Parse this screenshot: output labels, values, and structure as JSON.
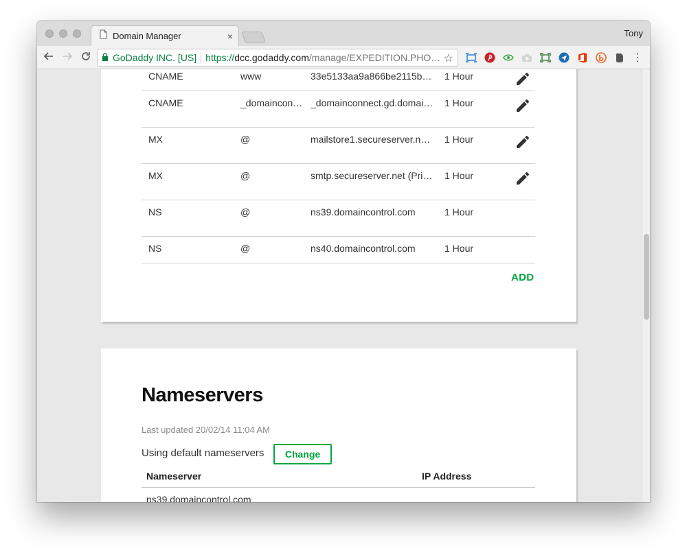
{
  "browser": {
    "tab_title": "Domain Manager",
    "tab_close": "×",
    "profile_name": "Tony",
    "secure_label": "GoDaddy INC. [US]",
    "url_scheme": "https://",
    "url_host": "dcc.godaddy.com",
    "url_path": "/manage/EXPEDITION.PHO…",
    "bookmark_star": "☆",
    "extension_icons": [
      "screen-capture-icon",
      "pinterest-icon",
      "eye-extension-icon",
      "camera-icon",
      "fullscreen-icon",
      "send-icon",
      "office-icon",
      "b-extension-icon",
      "evernote-icon"
    ],
    "menu_label": "⋮"
  },
  "dns_records": {
    "rows": [
      {
        "type": "CNAME",
        "name": "www",
        "value": "33e5133aa9a866be2115b…",
        "ttl": "1 Hour",
        "editable": true
      },
      {
        "type": "CNAME",
        "name": "_domaincon…",
        "value": "_domainconnect.gd.domai…",
        "ttl": "1 Hour",
        "editable": true
      },
      {
        "type": "MX",
        "name": "@",
        "value": "mailstore1.secureserver.ne…",
        "ttl": "1 Hour",
        "editable": true
      },
      {
        "type": "MX",
        "name": "@",
        "value": "smtp.secureserver.net (Prio…",
        "ttl": "1 Hour",
        "editable": true
      },
      {
        "type": "NS",
        "name": "@",
        "value": "ns39.domaincontrol.com",
        "ttl": "1 Hour",
        "editable": false
      },
      {
        "type": "NS",
        "name": "@",
        "value": "ns40.domaincontrol.com",
        "ttl": "1 Hour",
        "editable": false
      }
    ],
    "add_label": "ADD"
  },
  "nameservers": {
    "title": "Nameservers",
    "last_updated": "Last updated 20/02/14 11:04 AM",
    "using_text": "Using default nameservers",
    "change_label": "Change",
    "columns": [
      "Nameserver",
      "IP Address"
    ],
    "rows": [
      {
        "nameserver": "ns39.domaincontrol.com",
        "ip": ""
      }
    ]
  },
  "colors": {
    "accent_green": "#00a63f",
    "secure_green": "#0b8043"
  }
}
